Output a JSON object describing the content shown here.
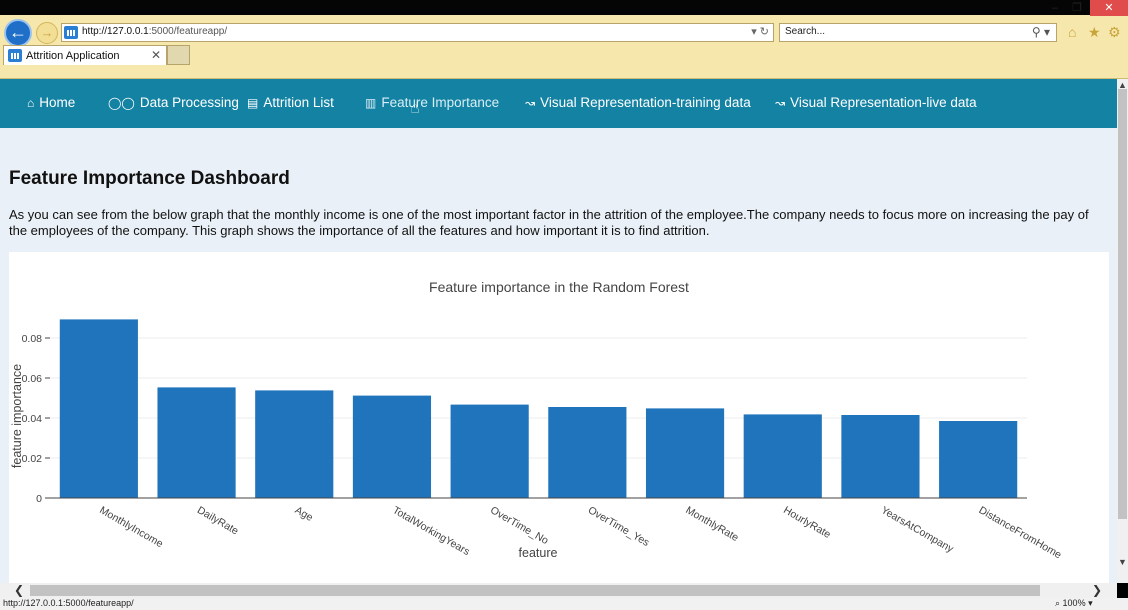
{
  "browser": {
    "url_host": "http://127.0.0.1",
    "url_rest": ":5000/featureapp/",
    "search_placeholder": "Search...",
    "tab_title": "Attrition Application",
    "status_url": "http://127.0.0.1:5000/featureapp/",
    "zoom": "100%"
  },
  "nav": {
    "items": [
      {
        "label": "Home",
        "icon": "home-icon"
      },
      {
        "label": "Data Processing",
        "icon": "glasses-icon"
      },
      {
        "label": "Attrition List",
        "icon": "list-icon"
      },
      {
        "label": "Feature Importance",
        "icon": "bar-chart-icon"
      },
      {
        "label": "Visual Representation-training data",
        "icon": "line-chart-icon"
      },
      {
        "label": "Visual Representation-live data",
        "icon": "line-chart-icon"
      }
    ]
  },
  "main": {
    "title": "Feature Importance Dashboard",
    "description": "As you can see from the below graph that the monthly income is one of the most important factor in the attrition of the employee.The company needs to focus more on increasing the pay of the employees of the company. This graph shows the importance of all the features and how important it is to find attrition."
  },
  "chart_data": {
    "type": "bar",
    "title": "Feature importance in the Random Forest",
    "xlabel": "feature",
    "ylabel": "feature importance",
    "categories": [
      "MonthlyIncome",
      "DailyRate",
      "Age",
      "TotalWorkingYears",
      "OverTime_No",
      "OverTime_Yes",
      "MonthlyRate",
      "HourlyRate",
      "YearsAtCompany",
      "DistanceFromHome"
    ],
    "values": [
      0.0893,
      0.0553,
      0.0538,
      0.0512,
      0.0467,
      0.0455,
      0.0448,
      0.0418,
      0.0415,
      0.0385
    ],
    "yticks": [
      "0",
      "0.02",
      "0.04",
      "0.06",
      "0.08"
    ],
    "ylim": [
      0,
      0.09
    ],
    "grid": true,
    "color": "#1f74bb"
  }
}
